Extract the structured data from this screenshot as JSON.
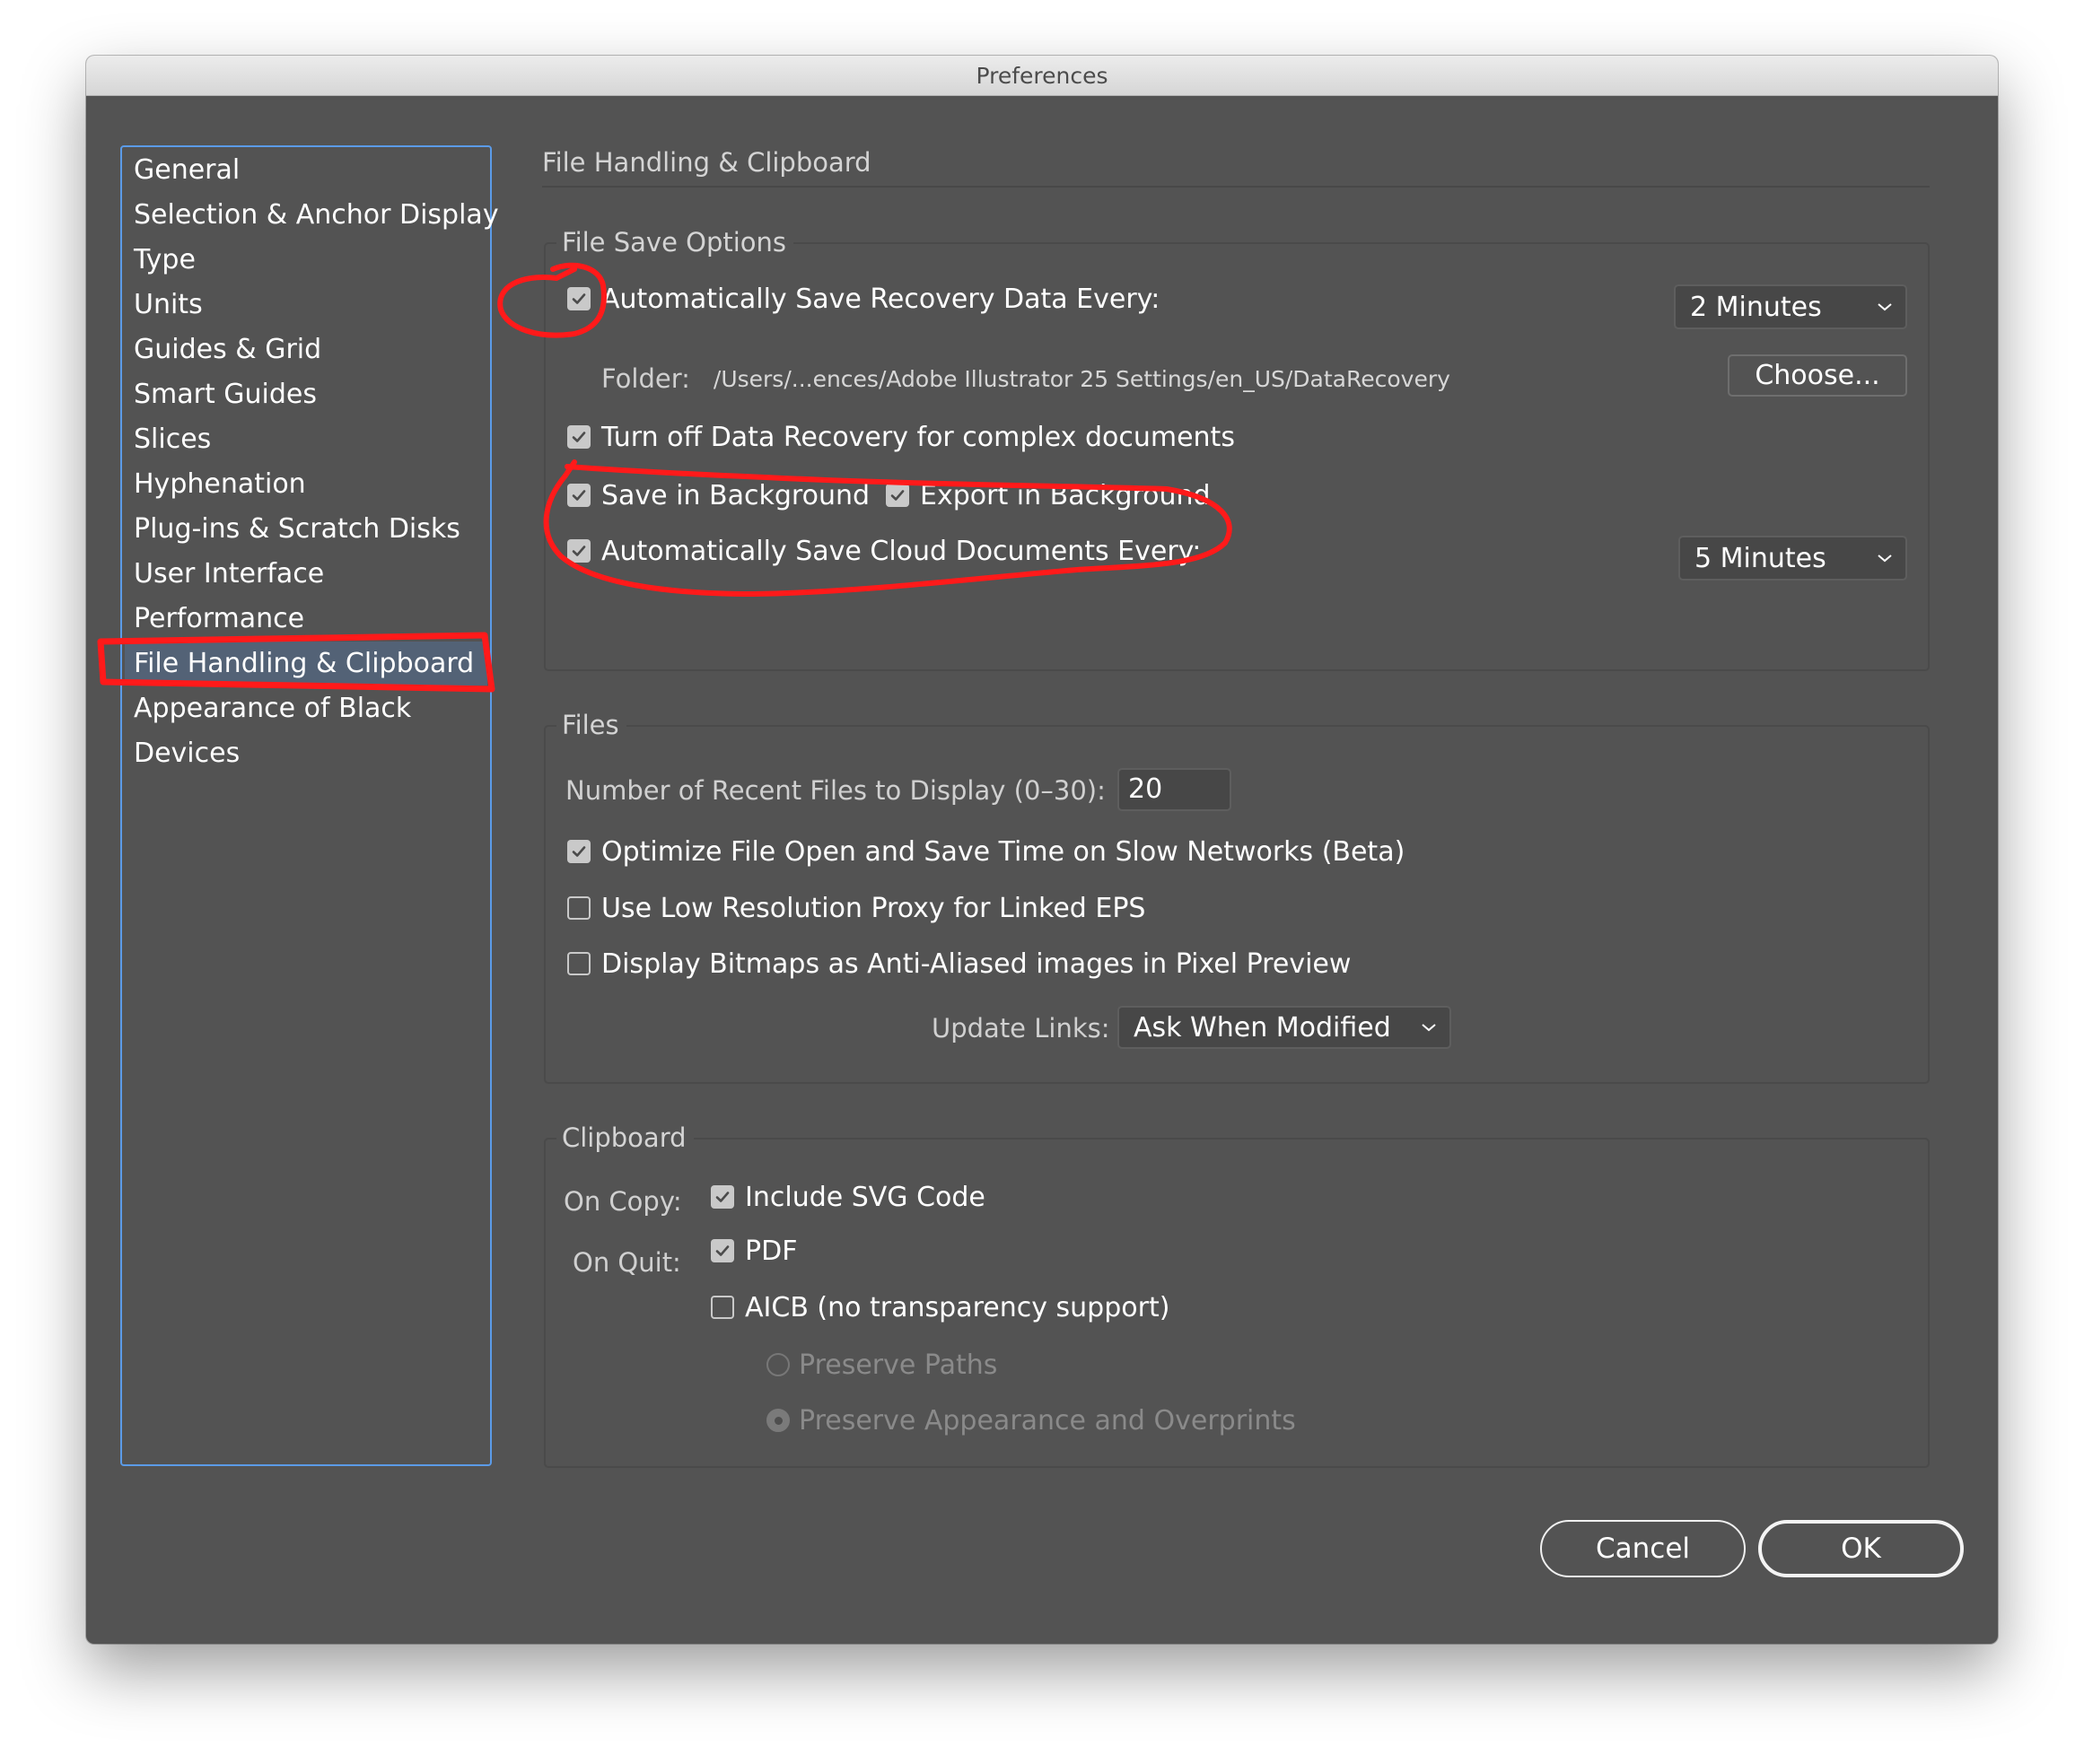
{
  "window": {
    "title": "Preferences"
  },
  "sidebar": {
    "items": [
      {
        "label": "General"
      },
      {
        "label": "Selection & Anchor Display"
      },
      {
        "label": "Type"
      },
      {
        "label": "Units"
      },
      {
        "label": "Guides & Grid"
      },
      {
        "label": "Smart Guides"
      },
      {
        "label": "Slices"
      },
      {
        "label": "Hyphenation"
      },
      {
        "label": "Plug-ins & Scratch Disks"
      },
      {
        "label": "User Interface"
      },
      {
        "label": "Performance"
      },
      {
        "label": "File Handling & Clipboard",
        "selected": true
      },
      {
        "label": "Appearance of Black"
      },
      {
        "label": "Devices"
      }
    ]
  },
  "page": {
    "title": "File Handling & Clipboard"
  },
  "file_save": {
    "legend": "File Save Options",
    "auto_save_recovery": {
      "label": "Automatically Save Recovery Data Every:",
      "checked": true,
      "interval": "2 Minutes"
    },
    "folder": {
      "label": "Folder:",
      "path": "/Users/...ences/Adobe Illustrator 25 Settings/en_US/DataRecovery",
      "choose_label": "Choose..."
    },
    "turn_off_recovery": {
      "label": "Turn off Data Recovery for complex documents",
      "checked": true
    },
    "save_in_background": {
      "label": "Save in Background",
      "checked": true
    },
    "export_in_background": {
      "label": "Export in Background",
      "checked": true
    },
    "auto_save_cloud": {
      "label": "Automatically Save Cloud Documents Every:",
      "checked": true,
      "interval": "5 Minutes"
    }
  },
  "files": {
    "legend": "Files",
    "recent_files": {
      "label": "Number of Recent Files to Display (0–30):",
      "value": "20"
    },
    "optimize_slow_networks": {
      "label": "Optimize File Open and Save Time on Slow Networks (Beta)",
      "checked": true
    },
    "low_res_proxy": {
      "label": "Use Low Resolution Proxy for Linked EPS",
      "checked": false
    },
    "antialiased_bitmaps": {
      "label": "Display Bitmaps as Anti-Aliased images in Pixel Preview",
      "checked": false
    },
    "update_links": {
      "label": "Update Links:",
      "value": "Ask When Modified"
    }
  },
  "clipboard": {
    "legend": "Clipboard",
    "on_copy_label": "On Copy:",
    "on_quit_label": "On Quit:",
    "include_svg": {
      "label": "Include SVG Code",
      "checked": true
    },
    "pdf": {
      "label": "PDF",
      "checked": true
    },
    "aicb": {
      "label": "AICB (no transparency support)",
      "checked": false
    },
    "preserve_paths": {
      "label": "Preserve Paths",
      "selected": false,
      "enabled": false
    },
    "preserve_appearance": {
      "label": "Preserve Appearance and Overprints",
      "selected": true,
      "enabled": false
    }
  },
  "buttons": {
    "cancel": "Cancel",
    "ok": "OK"
  },
  "colors": {
    "window_bg": "#535353",
    "selection_bg": "#536276",
    "sidebar_border": "#5b9be8",
    "annotation": "#ff1a1a"
  }
}
